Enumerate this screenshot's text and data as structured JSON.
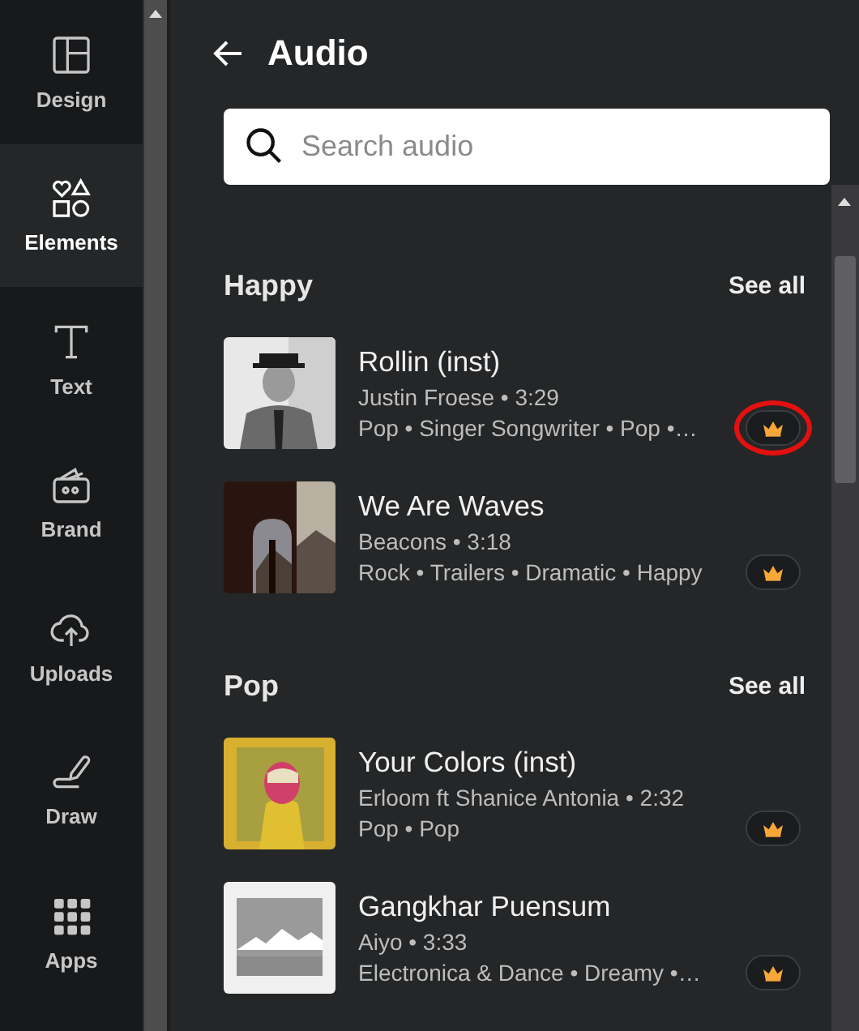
{
  "nav": [
    {
      "label": "Design",
      "selected": false
    },
    {
      "label": "Elements",
      "selected": true
    },
    {
      "label": "Text",
      "selected": false
    },
    {
      "label": "Brand",
      "selected": false
    },
    {
      "label": "Uploads",
      "selected": false
    },
    {
      "label": "Draw",
      "selected": false
    },
    {
      "label": "Apps",
      "selected": false
    }
  ],
  "panel": {
    "title": "Audio",
    "search": {
      "placeholder": "Search audio"
    }
  },
  "sections": [
    {
      "title": "Happy",
      "see_all": "See all",
      "tracks": [
        {
          "title": "Rollin (inst)",
          "byline": "Justin Froese • 3:29",
          "tags": "Pop • Singer Songwriter • Pop •…",
          "premium": true,
          "highlighted": true
        },
        {
          "title": "We Are Waves",
          "byline": "Beacons • 3:18",
          "tags": "Rock • Trailers • Dramatic • Happy",
          "premium": true,
          "highlighted": false
        }
      ]
    },
    {
      "title": "Pop",
      "see_all": "See all",
      "tracks": [
        {
          "title": "Your Colors (inst)",
          "byline": "Erloom ft Shanice Antonia • 2:32",
          "tags": "Pop • Pop",
          "premium": true,
          "highlighted": false
        },
        {
          "title": "Gangkhar Puensum",
          "byline": "Aiyo • 3:33",
          "tags": "Electronica & Dance • Dreamy •…",
          "premium": true,
          "highlighted": false
        }
      ]
    }
  ]
}
